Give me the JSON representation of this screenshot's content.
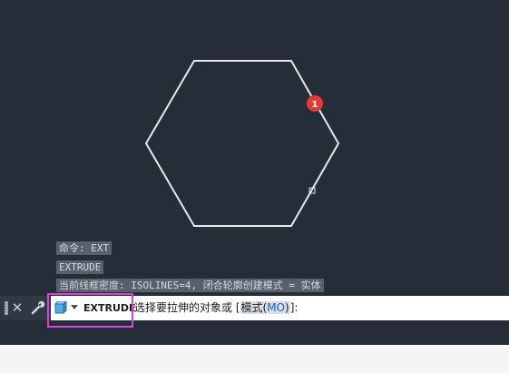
{
  "history": [
    "命令: EXT",
    "EXTRUDE",
    "当前线框密度:  ISOLINES=4, 闭合轮廓创建模式 = 实体"
  ],
  "marker": {
    "label": "1",
    "color": "#e03a3a"
  },
  "command_line": {
    "command_name": "EXTRUDE",
    "prompt_text": "选择要拉伸的对象或 [",
    "option_label": "模式(",
    "option_key": "MO",
    "option_close": ")",
    "prompt_end": "]:"
  },
  "icons": {
    "close": "close-icon",
    "wrench": "wrench-icon",
    "command": "extrude-command-icon",
    "dropdown": "chevron-down-icon"
  },
  "colors": {
    "highlight": "#e03ee0",
    "option_key": "#1f5dbf",
    "viewport": "#252d39"
  }
}
